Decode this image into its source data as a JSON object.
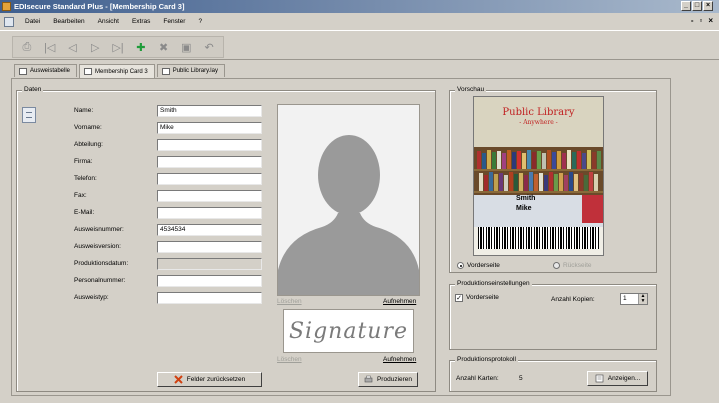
{
  "window": {
    "title": "EDIsecure Standard Plus - [Membership Card 3]"
  },
  "menu": {
    "items": [
      "Datei",
      "Bearbeiten",
      "Ansicht",
      "Extras",
      "Fenster",
      "?"
    ]
  },
  "toolbar": {
    "icons": [
      "print-icon",
      "first-icon",
      "prev-icon",
      "next-icon",
      "last-icon",
      "add-icon",
      "delete-icon",
      "save-icon",
      "undo-icon"
    ]
  },
  "tabs": [
    "Ausweistabelle",
    "Membership Card 3",
    "Public Library.lay"
  ],
  "data_group": {
    "title": "Daten",
    "fields": [
      {
        "label": "Name:",
        "value": "Smith"
      },
      {
        "label": "Vorname:",
        "value": "Mike"
      },
      {
        "label": "Abteilung:",
        "value": ""
      },
      {
        "label": "Firma:",
        "value": ""
      },
      {
        "label": "Telefon:",
        "value": ""
      },
      {
        "label": "Fax:",
        "value": ""
      },
      {
        "label": "E-Mail:",
        "value": ""
      },
      {
        "label": "Ausweisnummer:",
        "value": "4534534"
      },
      {
        "label": "Ausweisversion:",
        "value": ""
      },
      {
        "label": "Produktionsdatum:",
        "value": ""
      },
      {
        "label": "Personalnummer:",
        "value": ""
      },
      {
        "label": "Ausweistyp:",
        "value": ""
      }
    ],
    "photo_delete": "Löschen",
    "photo_capture": "Aufnehmen",
    "signature_text": "Signature",
    "signature_delete": "Löschen",
    "signature_capture": "Aufnehmen",
    "reset_button": "Felder zurücksetzen",
    "produce_button": "Produzieren"
  },
  "preview": {
    "title": "Vorschau",
    "card_title": "Public Library",
    "card_subtitle": "- Anywhere -",
    "card_name_1": "Smith",
    "card_name_2": "Mike",
    "front": "Vorderseite",
    "back": "Rückseite"
  },
  "production_settings": {
    "title": "Produktionseinstellungen",
    "front_label": "Vorderseite",
    "copies_label": "Anzahl Kopien:",
    "copies_value": "1"
  },
  "production_log": {
    "title": "Produktionsprotokoll",
    "cards_label": "Anzahl Karten:",
    "cards_value": "5",
    "show_button": "Anzeigen..."
  }
}
